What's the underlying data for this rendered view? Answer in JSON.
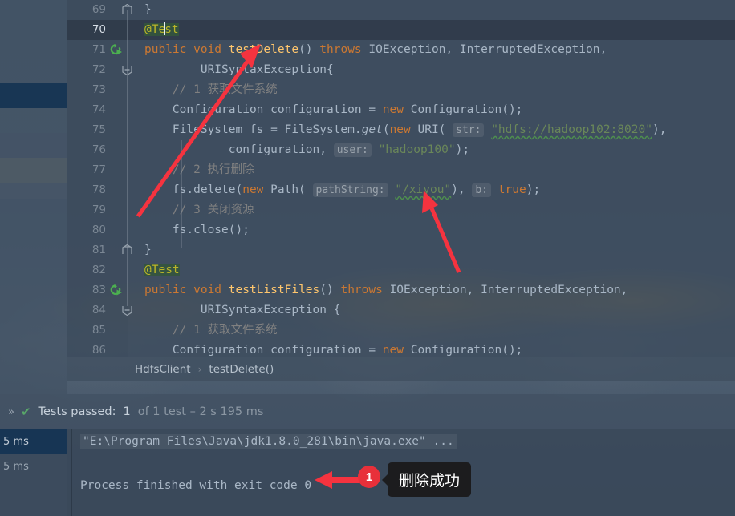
{
  "editor": {
    "lines": [
      {
        "num": "69",
        "indent": 0,
        "tokens": [
          {
            "t": "}",
            "c": "txt"
          }
        ],
        "current": false,
        "fold": "end",
        "run": false
      },
      {
        "num": "70",
        "indent": 0,
        "tokens": [
          {
            "t": "@Test",
            "c": "anno-hl-anno"
          }
        ],
        "current": true,
        "fold": "",
        "run": false
      },
      {
        "num": "71",
        "indent": 0,
        "tokens": [
          {
            "t": "public ",
            "c": "kw"
          },
          {
            "t": "void ",
            "c": "kw"
          },
          {
            "t": "testDelete",
            "c": "meth"
          },
          {
            "t": "() ",
            "c": "txt"
          },
          {
            "t": "throws ",
            "c": "kw"
          },
          {
            "t": "IOException, InterruptedException,",
            "c": "txt"
          }
        ],
        "current": false,
        "fold": "",
        "run": true
      },
      {
        "num": "72",
        "indent": 0,
        "tokens": [
          {
            "t": "        URISyntaxException{",
            "c": "txt"
          }
        ],
        "current": false,
        "fold": "start",
        "run": false
      },
      {
        "num": "73",
        "indent": 0,
        "tokens": [
          {
            "t": "    // 1 获取文件系统",
            "c": "cmt"
          }
        ],
        "current": false,
        "fold": "",
        "run": false
      },
      {
        "num": "74",
        "indent": 0,
        "tokens": [
          {
            "t": "    Configuration configuration = ",
            "c": "txt"
          },
          {
            "t": "new ",
            "c": "kw"
          },
          {
            "t": "Configuration();",
            "c": "txt"
          }
        ],
        "current": false,
        "fold": "",
        "run": false
      },
      {
        "num": "75",
        "indent": 0,
        "tokens": [
          {
            "t": "    FileSystem fs = FileSystem.",
            "c": "txt"
          },
          {
            "t": "get",
            "c": "txt-italic"
          },
          {
            "t": "(",
            "c": "txt"
          },
          {
            "t": "new ",
            "c": "kw"
          },
          {
            "t": "URI( ",
            "c": "txt"
          },
          {
            "t": "str:",
            "c": "hint"
          },
          {
            "t": " ",
            "c": "txt"
          },
          {
            "t": "\"hdfs://hadoop102:8020\"",
            "c": "str-wavy"
          },
          {
            "t": "),",
            "c": "txt"
          }
        ],
        "current": false,
        "fold": "",
        "run": false
      },
      {
        "num": "76",
        "indent": 0,
        "tokens": [
          {
            "t": "            configuration, ",
            "c": "txt"
          },
          {
            "t": "user:",
            "c": "hint"
          },
          {
            "t": " ",
            "c": "txt"
          },
          {
            "t": "\"hadoop100\"",
            "c": "str"
          },
          {
            "t": ");",
            "c": "txt"
          }
        ],
        "current": false,
        "fold": "",
        "run": false
      },
      {
        "num": "77",
        "indent": 0,
        "tokens": [
          {
            "t": "    // 2 执行删除",
            "c": "cmt"
          }
        ],
        "current": false,
        "fold": "",
        "run": false
      },
      {
        "num": "78",
        "indent": 0,
        "tokens": [
          {
            "t": "    fs.delete(",
            "c": "txt"
          },
          {
            "t": "new ",
            "c": "kw"
          },
          {
            "t": "Path( ",
            "c": "txt"
          },
          {
            "t": "pathString:",
            "c": "hint"
          },
          {
            "t": " ",
            "c": "txt"
          },
          {
            "t": "\"/xiyou\"",
            "c": "str-wavy"
          },
          {
            "t": "), ",
            "c": "txt"
          },
          {
            "t": "b:",
            "c": "hint"
          },
          {
            "t": " ",
            "c": "txt"
          },
          {
            "t": "true",
            "c": "kw"
          },
          {
            "t": ");",
            "c": "txt"
          }
        ],
        "current": false,
        "fold": "",
        "run": false
      },
      {
        "num": "79",
        "indent": 0,
        "tokens": [
          {
            "t": "    // 3 关闭资源",
            "c": "cmt"
          }
        ],
        "current": false,
        "fold": "",
        "run": false
      },
      {
        "num": "80",
        "indent": 0,
        "tokens": [
          {
            "t": "    fs.close();",
            "c": "txt"
          }
        ],
        "current": false,
        "fold": "",
        "run": false
      },
      {
        "num": "81",
        "indent": 0,
        "tokens": [
          {
            "t": "}",
            "c": "txt"
          }
        ],
        "current": false,
        "fold": "end",
        "run": false
      },
      {
        "num": "82",
        "indent": 0,
        "tokens": [
          {
            "t": "@Test",
            "c": "anno-hl-anno"
          }
        ],
        "current": false,
        "fold": "",
        "run": false
      },
      {
        "num": "83",
        "indent": 0,
        "tokens": [
          {
            "t": "public ",
            "c": "kw"
          },
          {
            "t": "void ",
            "c": "kw"
          },
          {
            "t": "testListFiles",
            "c": "meth"
          },
          {
            "t": "() ",
            "c": "txt"
          },
          {
            "t": "throws ",
            "c": "kw"
          },
          {
            "t": "IOException, InterruptedException,",
            "c": "txt"
          }
        ],
        "current": false,
        "fold": "",
        "run": true
      },
      {
        "num": "84",
        "indent": 0,
        "tokens": [
          {
            "t": "        URISyntaxException {",
            "c": "txt"
          }
        ],
        "current": false,
        "fold": "start",
        "run": false
      },
      {
        "num": "85",
        "indent": 0,
        "tokens": [
          {
            "t": "    // 1 获取文件系统",
            "c": "cmt"
          }
        ],
        "current": false,
        "fold": "",
        "run": false
      },
      {
        "num": "86",
        "indent": 0,
        "tokens": [
          {
            "t": "    Configuration configuration = ",
            "c": "txt"
          },
          {
            "t": "new ",
            "c": "kw"
          },
          {
            "t": "Configuration();",
            "c": "txt"
          }
        ],
        "current": false,
        "fold": "",
        "run": false
      }
    ]
  },
  "breadcrumb": {
    "class_name": "HdfsClient",
    "separator": "›",
    "method_name": "testDelete()"
  },
  "status_bar": {
    "expand_chevrons": "»",
    "check_icon": "✔",
    "label": "Tests passed:",
    "count": "1",
    "detail": "of 1 test – 2 s 195 ms"
  },
  "test_tree": {
    "rows": [
      {
        "time": "5 ms",
        "selected": true
      },
      {
        "time": "5 ms",
        "selected": false
      }
    ]
  },
  "console": {
    "command_line": "\"E:\\Program Files\\Java\\jdk1.8.0_281\\bin\\java.exe\" ...",
    "exit_line": "Process finished with exit code 0"
  },
  "annotations": {
    "badge_number": "1",
    "callout_text": "删除成功",
    "arrow_color": "#f5333f"
  },
  "colors": {
    "keyword": "#cc7832",
    "method": "#ffc66d",
    "annotation": "#bbb529",
    "string": "#6a8759",
    "comment": "#808080",
    "text": "#a9b7c6",
    "accent_red": "#e8303a",
    "success_green": "#59a869",
    "selection_blue": "#153453"
  }
}
